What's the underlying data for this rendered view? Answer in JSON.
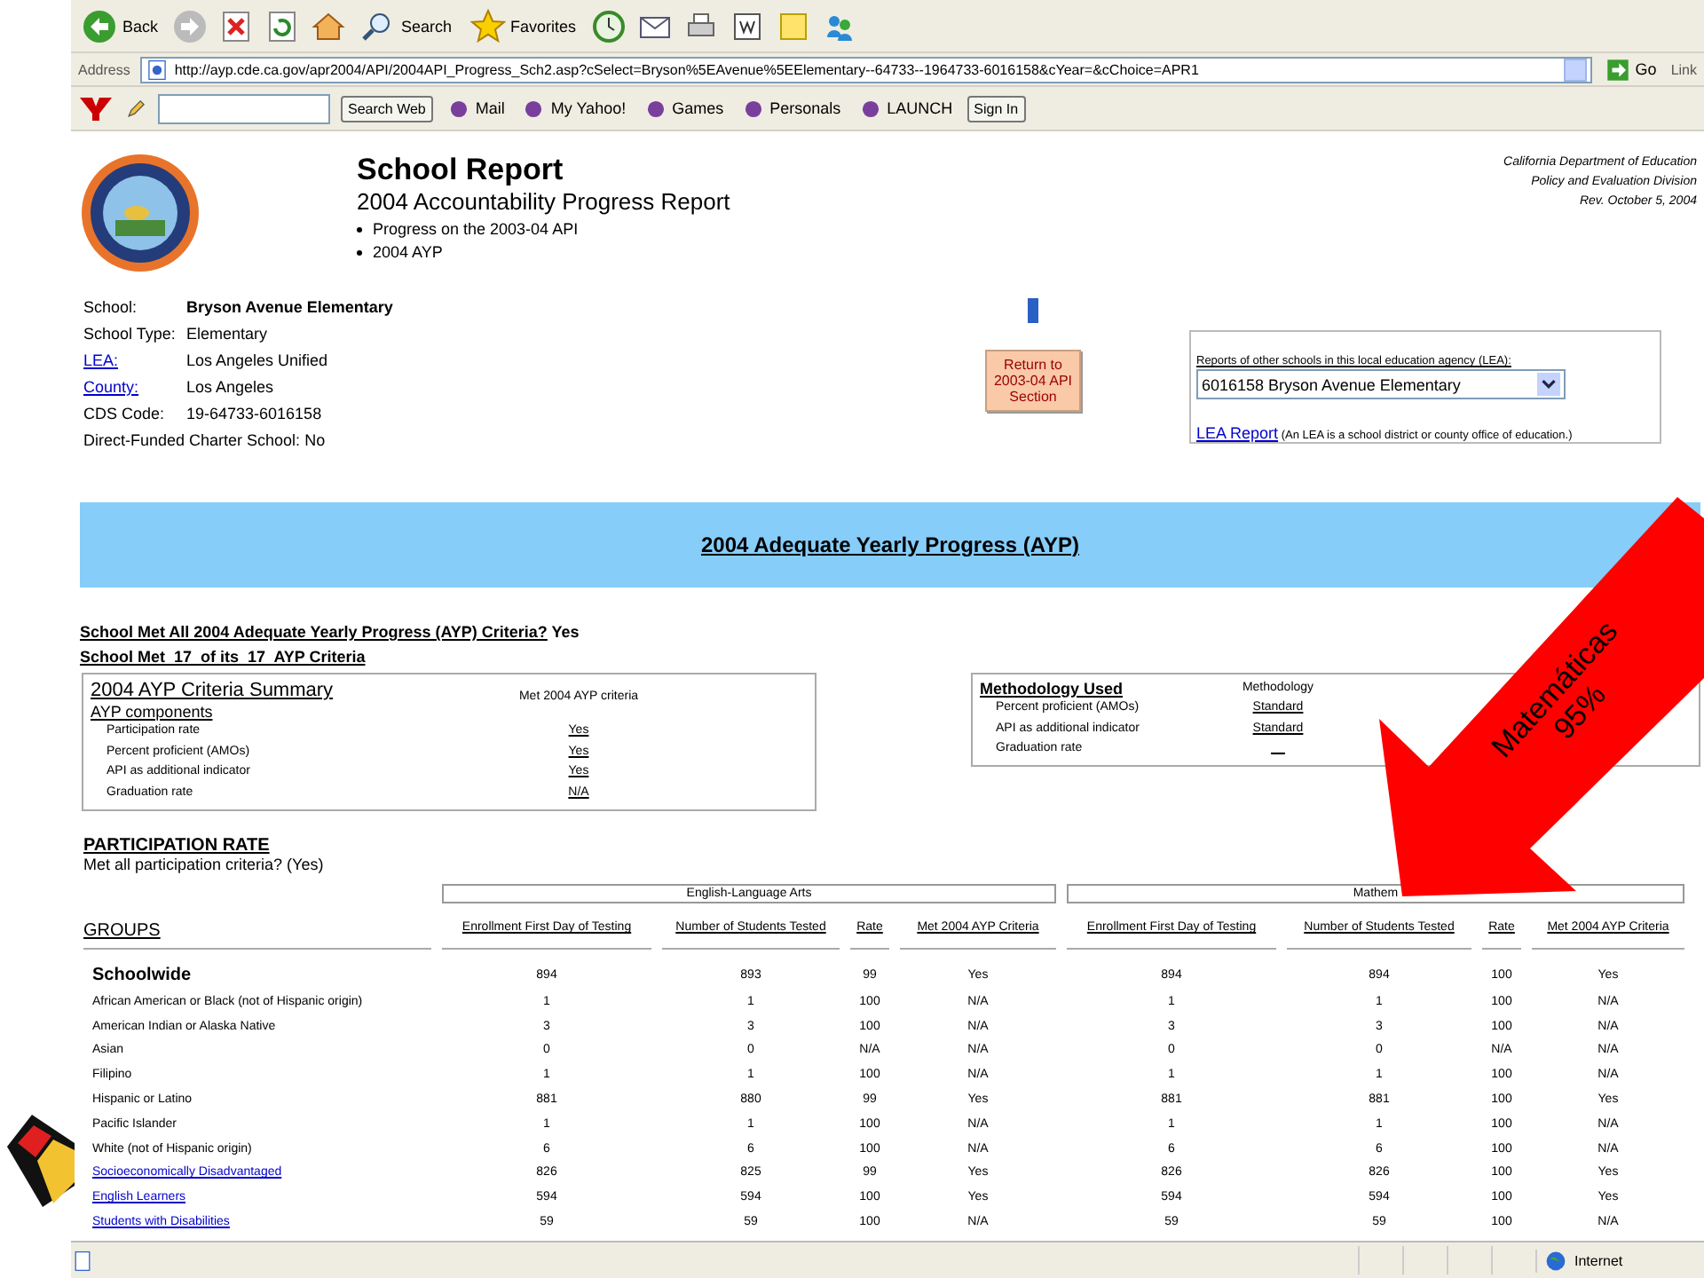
{
  "toolbar": {
    "back": "Back",
    "search": "Search",
    "favorites": "Favorites"
  },
  "address_bar": {
    "label": "Address",
    "url": "http://ayp.cde.ca.gov/apr2004/API/2004API_Progress_Sch2.asp?cSelect=Bryson%5EAvenue%5EElementary--64733--1964733-6016158&cYear=&cChoice=APR1",
    "go": "Go",
    "links": "Link"
  },
  "yahoo_bar": {
    "search_button": "Search Web",
    "items": [
      "Mail",
      "My Yahoo!",
      "Games",
      "Personals",
      "LAUNCH"
    ],
    "sign_in": "Sign In"
  },
  "header": {
    "title": "School Report",
    "subtitle": "2004 Accountability Progress Report",
    "bullets": [
      "Progress on the 2003-04 API",
      "2004 AYP"
    ],
    "agency": [
      "California Department of Education",
      "Policy and Evaluation Division",
      "Rev. October 5, 2004"
    ]
  },
  "school_info": [
    {
      "label": "School:",
      "value": "Bryson Avenue Elementary",
      "kind": "bold"
    },
    {
      "label": "School Type:",
      "value": "Elementary",
      "kind": "plain"
    },
    {
      "label": "LEA:",
      "value": "Los Angeles Unified",
      "kind": "link"
    },
    {
      "label": "County:",
      "value": "Los Angeles",
      "kind": "link"
    },
    {
      "label": "CDS Code:",
      "value": "19-64733-6016158",
      "kind": "plain"
    },
    {
      "label": "Direct-Funded Charter School:",
      "value": "No",
      "kind": "wide"
    }
  ],
  "return_button": "Return to 2003-04 API Section",
  "lea_box": {
    "label": "Reports of other schools in this local education agency (LEA):",
    "select": "6016158 Bryson Avenue Elementary",
    "link": "LEA Report",
    "note": "(An LEA is a school district or county office of education.)"
  },
  "banner": "2004 Adequate Yearly Progress (AYP)",
  "criteria_met": {
    "question": "School Met All 2004 Adequate Yearly Progress (AYP) Criteria?",
    "answer": "Yes"
  },
  "criteria_count": "School Met  17  of its  17  AYP Criteria",
  "summary": {
    "title": "2004 AYP Criteria Summary",
    "subtitle": "AYP components",
    "column": "Met 2004 AYP criteria",
    "rows": [
      {
        "label": "Participation rate",
        "value": "Yes"
      },
      {
        "label": "Percent proficient (AMOs)",
        "value": "Yes"
      },
      {
        "label": "API as additional indicator",
        "value": "Yes"
      },
      {
        "label": "Graduation rate",
        "value": "N/A"
      }
    ]
  },
  "methodology": {
    "title": "Methodology Used",
    "column": "Methodology",
    "rows": [
      {
        "label": "Percent proficient (AMOs)",
        "value": "Standard"
      },
      {
        "label": "API as additional indicator",
        "value": "Standard"
      },
      {
        "label": "Graduation rate",
        "value": "__"
      }
    ]
  },
  "participation": {
    "title": "PARTICIPATION RATE",
    "met": "Met all participation criteria? (Yes)",
    "groups_header": "GROUPS",
    "subjects": [
      {
        "name": "English-Language Arts",
        "columns": [
          "Enrollment First Day of Testing",
          "Number of Students Tested",
          "Rate",
          "Met 2004 AYP Criteria"
        ]
      },
      {
        "name": "Mathem",
        "columns": [
          "Enrollment First Day of Testing",
          "Number of Students Tested",
          "Rate",
          "Met 2004 AYP Criteria"
        ]
      }
    ],
    "rows": [
      {
        "group": "Schoolwide",
        "kind": "total",
        "values": [
          "894",
          "893",
          "99",
          "Yes",
          "894",
          "894",
          "100",
          "Yes"
        ]
      },
      {
        "group": "African American or Black (not of Hispanic origin)",
        "kind": "plain",
        "values": [
          "1",
          "1",
          "100",
          "N/A",
          "1",
          "1",
          "100",
          "N/A"
        ]
      },
      {
        "group": "American Indian or Alaska Native",
        "kind": "plain",
        "values": [
          "3",
          "3",
          "100",
          "N/A",
          "3",
          "3",
          "100",
          "N/A"
        ]
      },
      {
        "group": "Asian",
        "kind": "plain",
        "values": [
          "0",
          "0",
          "N/A",
          "N/A",
          "0",
          "0",
          "N/A",
          "N/A"
        ]
      },
      {
        "group": "Filipino",
        "kind": "plain",
        "values": [
          "1",
          "1",
          "100",
          "N/A",
          "1",
          "1",
          "100",
          "N/A"
        ]
      },
      {
        "group": "Hispanic or Latino",
        "kind": "plain",
        "values": [
          "881",
          "880",
          "99",
          "Yes",
          "881",
          "881",
          "100",
          "Yes"
        ]
      },
      {
        "group": "Pacific Islander",
        "kind": "plain",
        "values": [
          "1",
          "1",
          "100",
          "N/A",
          "1",
          "1",
          "100",
          "N/A"
        ]
      },
      {
        "group": "White (not of Hispanic origin)",
        "kind": "plain",
        "values": [
          "6",
          "6",
          "100",
          "N/A",
          "6",
          "6",
          "100",
          "N/A"
        ]
      },
      {
        "group": "Socioeconomically Disadvantaged",
        "kind": "link",
        "values": [
          "826",
          "825",
          "99",
          "Yes",
          "826",
          "826",
          "100",
          "Yes"
        ]
      },
      {
        "group": "English Learners",
        "kind": "link",
        "values": [
          "594",
          "594",
          "100",
          "Yes",
          "594",
          "594",
          "100",
          "Yes"
        ]
      },
      {
        "group": "Students with Disabilities",
        "kind": "link",
        "values": [
          "59",
          "59",
          "100",
          "N/A",
          "59",
          "59",
          "100",
          "N/A"
        ]
      }
    ]
  },
  "status_bar": {
    "zone": "Internet"
  },
  "annotation": {
    "lines": [
      "Matemáticas",
      "95%"
    ]
  }
}
